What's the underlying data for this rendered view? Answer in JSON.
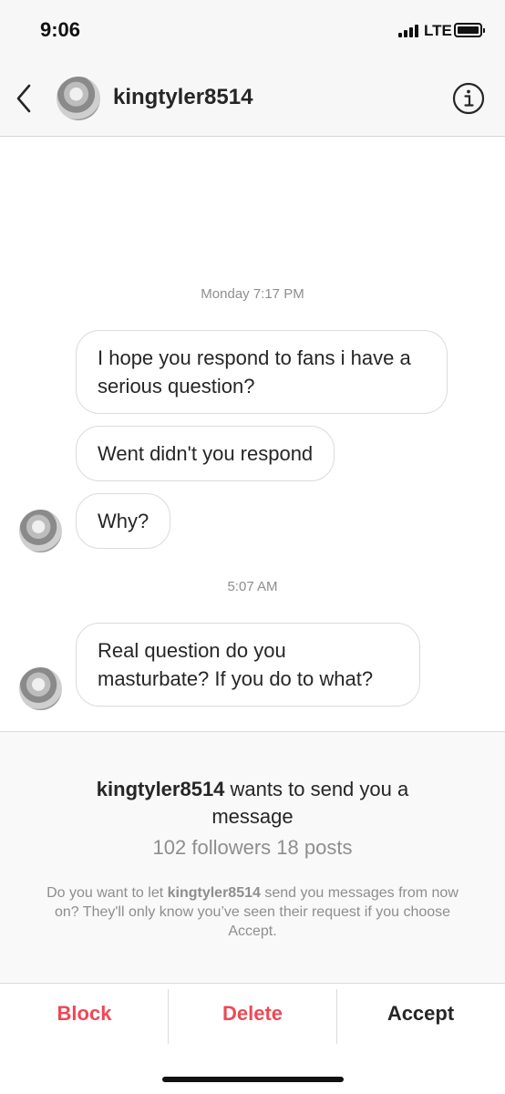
{
  "status_bar": {
    "time": "9:06",
    "network": "LTE",
    "icons": [
      "signal-icon",
      "battery-icon"
    ]
  },
  "header": {
    "username": "kingtyler8514",
    "icons": [
      "back-chevron-icon",
      "info-icon",
      "avatar"
    ]
  },
  "thread": {
    "timestamp_1": "Monday 7:17 PM",
    "message_1": "I hope you respond to fans i have a serious question?",
    "message_2": "Went didn't you respond",
    "message_3": "Why?",
    "timestamp_2": "5:07 AM",
    "message_4": "Real question do you masturbate? If you do to what?"
  },
  "request": {
    "title_username": "kingtyler8514",
    "title_rest": " wants to send you a message",
    "stats": "102 followers 18 posts",
    "info_prefix": "Do you want to let ",
    "info_username": "kingtyler8514",
    "info_suffix": " send you messages from now on? They'll only know you’ve seen their request if you choose Accept."
  },
  "actions": {
    "block_label": "Block",
    "delete_label": "Delete",
    "accept_label": "Accept"
  },
  "colors": {
    "destructive": "#ed4956",
    "text_primary": "#262626",
    "text_secondary": "#8e8e8e",
    "bubble_border": "#dbdbdb"
  }
}
